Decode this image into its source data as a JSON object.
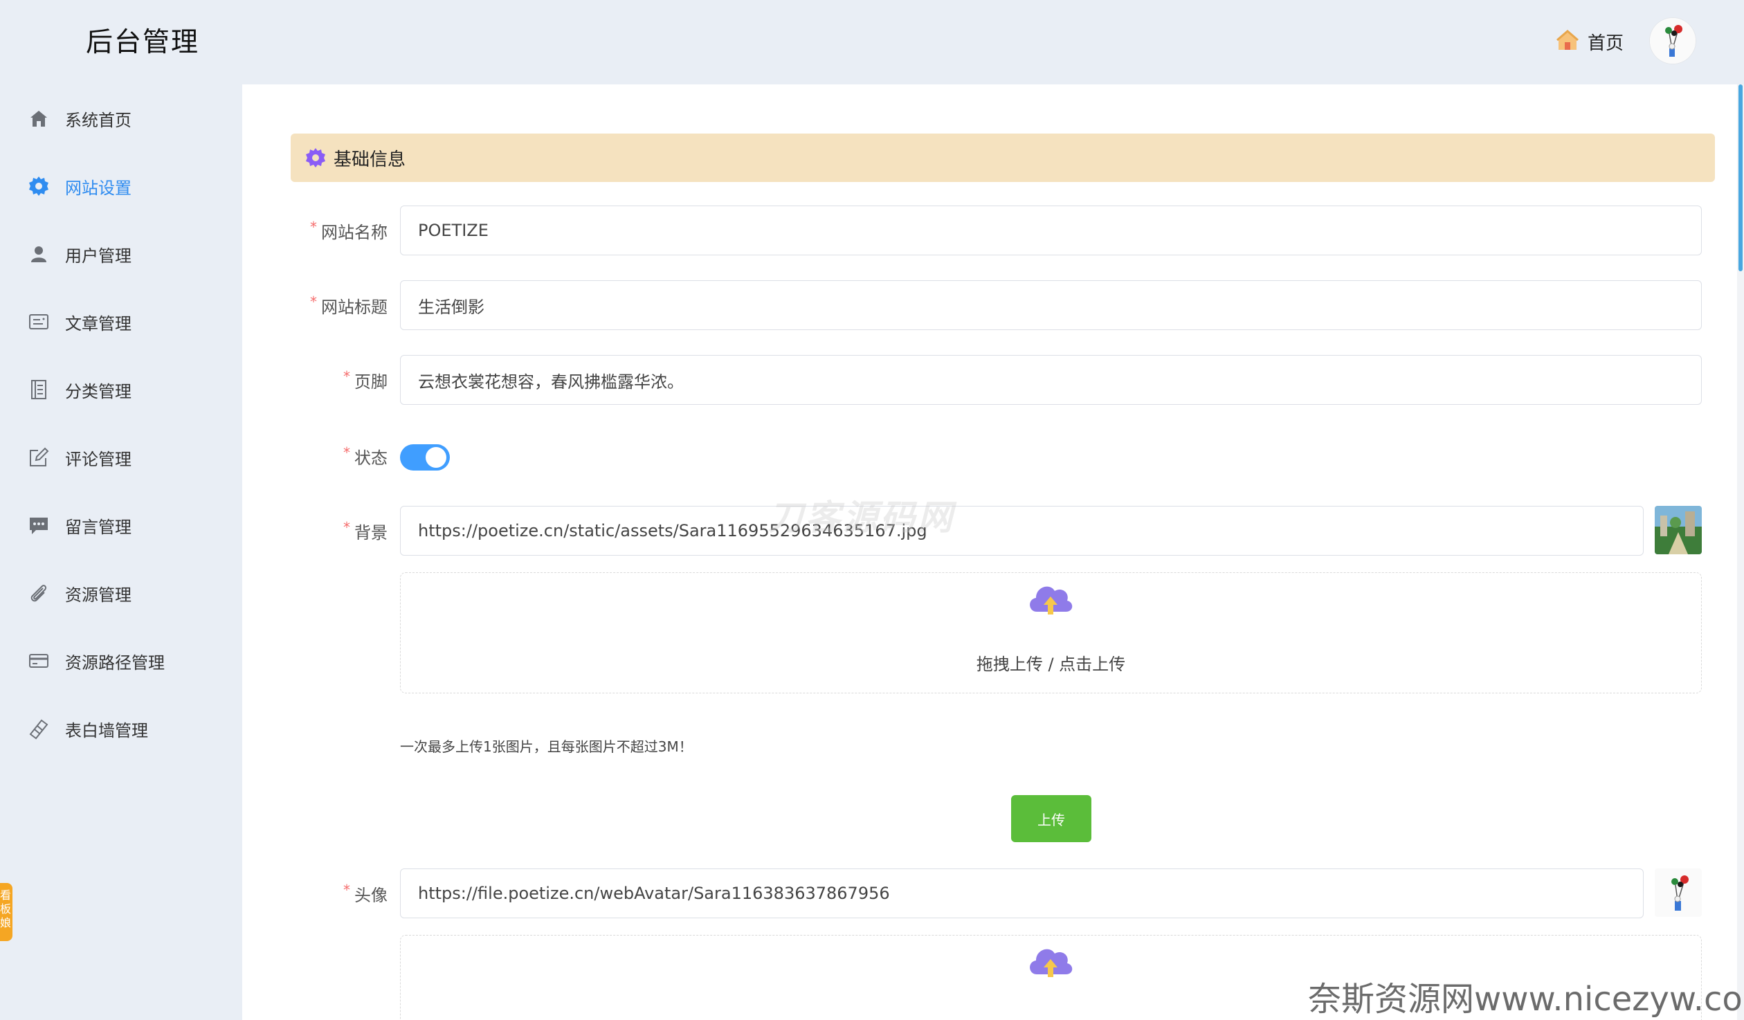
{
  "header": {
    "title": "后台管理",
    "home_label": "首页",
    "home_icon": "house-icon",
    "avatar_icon": "user-avatar"
  },
  "sidebar": {
    "items": [
      {
        "label": "系统首页",
        "icon": "home-icon"
      },
      {
        "label": "网站设置",
        "icon": "gear-icon",
        "active": true
      },
      {
        "label": "用户管理",
        "icon": "user-icon"
      },
      {
        "label": "文章管理",
        "icon": "article-icon"
      },
      {
        "label": "分类管理",
        "icon": "category-icon"
      },
      {
        "label": "评论管理",
        "icon": "edit-icon"
      },
      {
        "label": "留言管理",
        "icon": "message-icon"
      },
      {
        "label": "资源管理",
        "icon": "paperclip-icon"
      },
      {
        "label": "资源路径管理",
        "icon": "card-icon"
      },
      {
        "label": "表白墙管理",
        "icon": "ribbon-icon"
      }
    ],
    "side_tab_text": "看板娘",
    "active_color": "#2f8cf0"
  },
  "section": {
    "title": "基础信息",
    "icon": "gear-icon",
    "background": "#f5e2bf"
  },
  "form": {
    "name": {
      "label": "网站名称",
      "value": "POETIZE"
    },
    "title": {
      "label": "网站标题",
      "value": "生活倒影"
    },
    "footer": {
      "label": "页脚",
      "value": "云想衣裳花想容，春风拂槛露华浓。"
    },
    "status": {
      "label": "状态",
      "on": true
    },
    "background": {
      "label": "背景",
      "value": "https://poetize.cn/static/assets/Sara11695529634635167.jpg"
    },
    "avatar": {
      "label": "头像",
      "value": "https://file.poetize.cn/webAvatar/Sara116383637867956"
    },
    "required_mark": "*"
  },
  "upload": {
    "dropzone_text": "拖拽上传 / 点击上传",
    "tip": "一次最多上传1张图片，且每张图片不超过3M！",
    "button_label": "上传",
    "button_color": "#5bbd3a",
    "icon": "cloud-upload-icon"
  },
  "watermarks": {
    "center": "刀客源码网",
    "bottom_right": "奈斯资源网www.nicezyw.com"
  }
}
